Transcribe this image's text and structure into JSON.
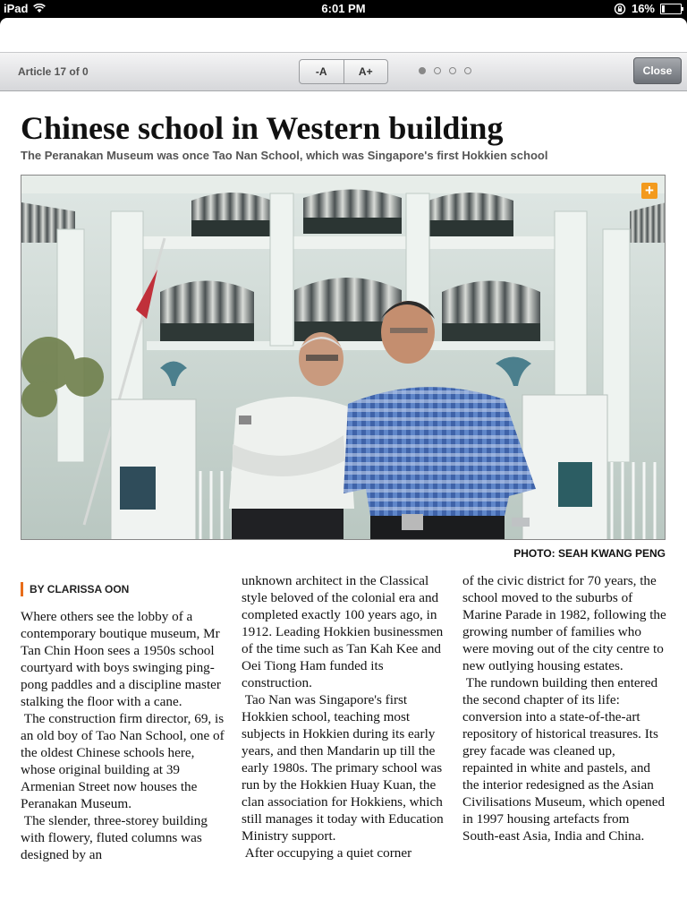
{
  "status_bar": {
    "device": "iPad",
    "time": "6:01 PM",
    "battery": "16%"
  },
  "toolbar": {
    "article_count": "Article 17 of 0",
    "font_decrease": "-A",
    "font_increase": "A+",
    "pages": 4,
    "active_page": 1,
    "close_label": "Close"
  },
  "article": {
    "headline": "Chinese school in Western building",
    "subheadline": "The Peranakan Museum was once Tao Nan School, which was Singapore's first Hokkien school",
    "photo_credit": "PHOTO: SEAH KWANG PENG",
    "byline": "BY CLARISSA OON",
    "columns": [
      {
        "paragraphs": [
          "Where others see the lobby of a contemporary boutique museum, Mr Tan Chin Hoon sees a 1950s school courtyard with boys swinging ping-pong paddles and a discipline master stalking the floor with a cane.",
          " The construction firm director, 69, is an old boy of Tao Nan School, one of the oldest Chinese schools here, whose original building at 39 Armenian Street now houses the Peranakan Museum.",
          " The slender, three-storey building with flowery, fluted columns was designed by an"
        ]
      },
      {
        "paragraphs": [
          "unknown architect in the Classical style beloved of the colonial era and completed exactly 100 years ago, in 1912. Leading Hokkien businessmen of the time such as Tan Kah Kee and Oei Tiong Ham funded its construction.",
          " Tao Nan was Singapore's first Hokkien school, teaching most subjects in Hokkien during its early years, and then Mandarin up till the early 1980s. The primary school was run by the Hokkien Huay Kuan, the clan association for Hokkiens, which still manages it today with Education Ministry support.",
          " After occupying a quiet corner"
        ]
      },
      {
        "paragraphs": [
          "of the civic district for 70 years, the school moved to the suburbs of Marine Parade in 1982, following the growing number of families who were moving out of the city centre to new outlying housing estates.",
          " The rundown building then entered the second chapter of its life: conversion into a state-of-the-art repository of historical treasures. Its grey facade was cleaned up, repainted in white and pastels, and the interior redesigned as the Asian Civilisations Museum, which opened in 1997 housing artefacts from South-east Asia, India and China."
        ]
      }
    ]
  },
  "colors": {
    "accent": "#e86d1a",
    "expand_icon": "#f39a1e"
  }
}
